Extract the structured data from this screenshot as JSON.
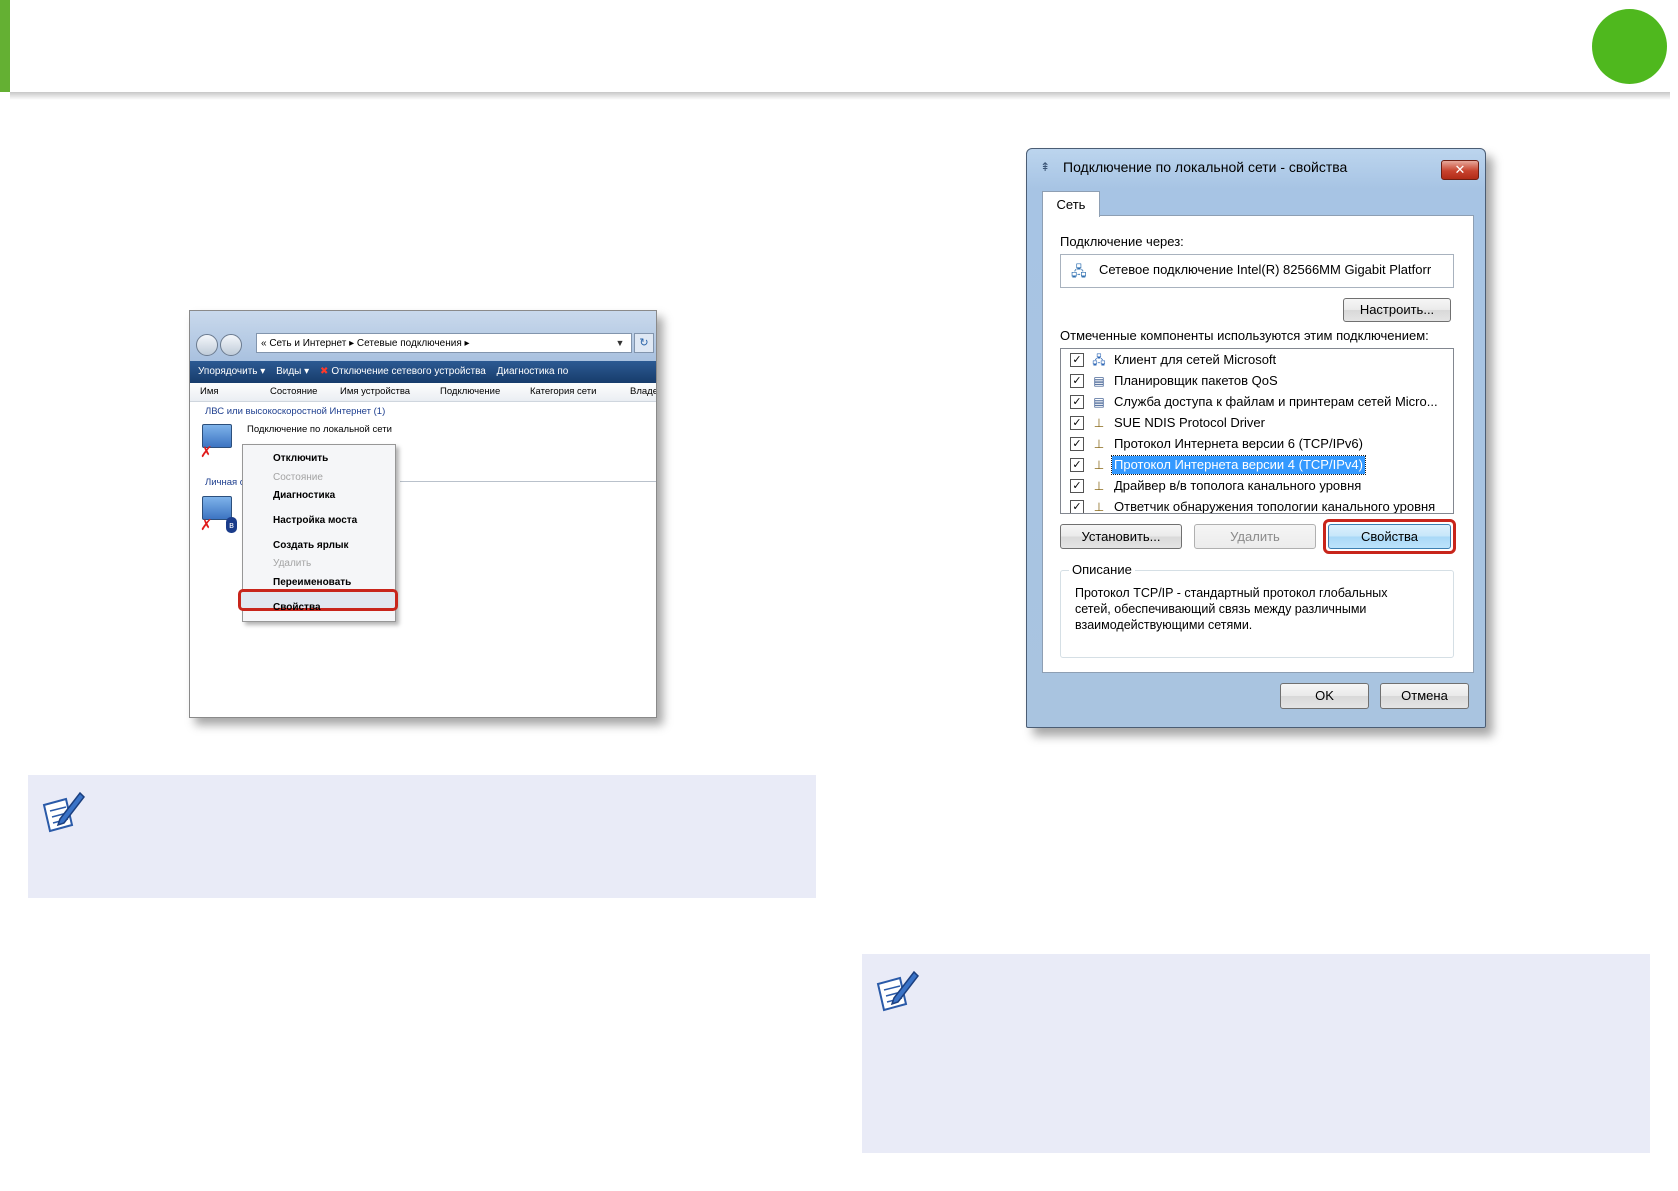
{
  "explorer": {
    "address": "« Сеть и Интернет ▸ Сетевые подключения ▸",
    "toolbar": [
      "Упорядочить ▾",
      "Виды ▾",
      "Отключение сетевого устройства",
      "Диагностика по"
    ],
    "columns": [
      "Имя",
      "Состояние",
      "Имя устройства",
      "Подключение",
      "Категория сети",
      "Владе"
    ],
    "group1": "ЛВС или высокоскоростной Интернет (1)",
    "item_name": "Подключение по локальной сети",
    "group2": "Личная с",
    "context_menu": {
      "items": [
        "Отключить",
        "Состояние",
        "Диагностика",
        "Настройка моста",
        "Создать ярлык",
        "Удалить",
        "Переименовать",
        "Свойства"
      ],
      "disabled": [
        "Состояние",
        "Удалить"
      ],
      "highlighted": "Свойства"
    }
  },
  "dialog": {
    "title": "Подключение по локальной сети - свойства",
    "close_glyph": "✕",
    "tab": "Сеть",
    "connect_via_label": "Подключение через:",
    "adapter": "Сетевое подключение Intel(R) 82566MM Gigabit Platforr",
    "configure_button": "Настроить...",
    "components_label": "Отмеченные компоненты используются этим подключением:",
    "components": [
      {
        "label": "Клиент для сетей Microsoft",
        "checked": true,
        "icon": "network-client-icon"
      },
      {
        "label": "Планировщик пакетов QoS",
        "checked": true,
        "icon": "service-icon"
      },
      {
        "label": "Служба доступа к файлам и принтерам сетей Micro...",
        "checked": true,
        "icon": "service-icon"
      },
      {
        "label": "SUE NDIS Protocol Driver",
        "checked": true,
        "icon": "protocol-icon"
      },
      {
        "label": "Протокол Интернета версии 6 (TCP/IPv6)",
        "checked": true,
        "icon": "protocol-icon"
      },
      {
        "label": "Протокол Интернета версии 4 (TCP/IPv4)",
        "checked": true,
        "icon": "protocol-icon",
        "selected": true
      },
      {
        "label": "Драйвер в/в тополога канального уровня",
        "checked": true,
        "icon": "protocol-icon"
      },
      {
        "label": "Ответчик обнаружения топологии канального уровня",
        "checked": true,
        "icon": "protocol-icon"
      }
    ],
    "install_button": "Установить...",
    "remove_button": "Удалить",
    "properties_button": "Свойства",
    "description_title": "Описание",
    "description_lines": [
      "Протокол TCP/IP - стандартный протокол глобальных",
      "сетей, обеспечивающий связь между различными",
      "взаимодействующими сетями."
    ],
    "ok_button": "OK",
    "cancel_button": "Отмена"
  },
  "colors": {
    "accent_green": "#64b033",
    "highlight_red": "#c8251b",
    "note_background": "#e9ebf7",
    "selection_blue": "#3399ff"
  }
}
